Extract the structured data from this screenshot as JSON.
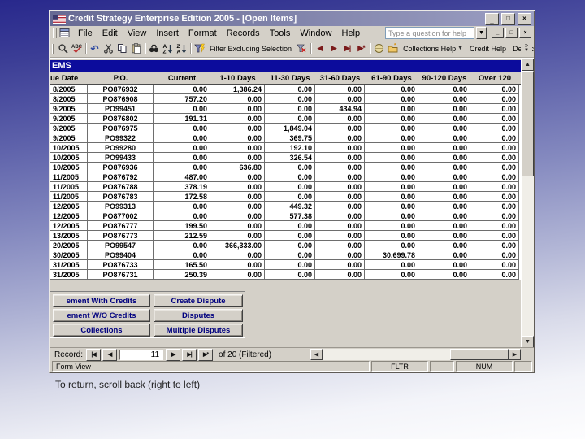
{
  "window": {
    "title": "Credit Strategy Enterprise Edition 2005 - [Open Items]"
  },
  "menu": {
    "items": [
      "File",
      "Edit",
      "View",
      "Insert",
      "Format",
      "Records",
      "Tools",
      "Window",
      "Help"
    ],
    "question_box": "Type a question for help"
  },
  "toolbar": {
    "filter_excluding_label": "Filter Excluding Selection",
    "collections_help_label": "Collections Help",
    "credit_help_label": "Credit Help",
    "deductions_help_label": "Deductions Help"
  },
  "form": {
    "header_label": "EMS"
  },
  "table": {
    "columns": [
      "ue Date",
      "P.O.",
      "Current",
      "1-10 Days",
      "11-30 Days",
      "31-60 Days",
      "61-90 Days",
      "90-120 Days",
      "Over 120"
    ],
    "rows": [
      [
        "8/2005",
        "PO876932",
        "0.00",
        "1,386.24",
        "0.00",
        "0.00",
        "0.00",
        "0.00",
        "0.00"
      ],
      [
        "8/2005",
        "PO876908",
        "757.20",
        "0.00",
        "0.00",
        "0.00",
        "0.00",
        "0.00",
        "0.00"
      ],
      [
        "9/2005",
        "PO99451",
        "0.00",
        "0.00",
        "0.00",
        "434.94",
        "0.00",
        "0.00",
        "0.00"
      ],
      [
        "9/2005",
        "PO876802",
        "191.31",
        "0.00",
        "0.00",
        "0.00",
        "0.00",
        "0.00",
        "0.00"
      ],
      [
        "9/2005",
        "PO876975",
        "0.00",
        "0.00",
        "1,849.04",
        "0.00",
        "0.00",
        "0.00",
        "0.00"
      ],
      [
        "9/2005",
        "PO99322",
        "0.00",
        "0.00",
        "369.75",
        "0.00",
        "0.00",
        "0.00",
        "0.00"
      ],
      [
        "10/2005",
        "PO99280",
        "0.00",
        "0.00",
        "192.10",
        "0.00",
        "0.00",
        "0.00",
        "0.00"
      ],
      [
        "10/2005",
        "PO99433",
        "0.00",
        "0.00",
        "326.54",
        "0.00",
        "0.00",
        "0.00",
        "0.00"
      ],
      [
        "10/2005",
        "PO876936",
        "0.00",
        "636.80",
        "0.00",
        "0.00",
        "0.00",
        "0.00",
        "0.00"
      ],
      [
        "11/2005",
        "PO876792",
        "487.00",
        "0.00",
        "0.00",
        "0.00",
        "0.00",
        "0.00",
        "0.00"
      ],
      [
        "11/2005",
        "PO876788",
        "378.19",
        "0.00",
        "0.00",
        "0.00",
        "0.00",
        "0.00",
        "0.00"
      ],
      [
        "11/2005",
        "PO876783",
        "172.58",
        "0.00",
        "0.00",
        "0.00",
        "0.00",
        "0.00",
        "0.00"
      ],
      [
        "12/2005",
        "PO99313",
        "0.00",
        "0.00",
        "449.32",
        "0.00",
        "0.00",
        "0.00",
        "0.00"
      ],
      [
        "12/2005",
        "PO877002",
        "0.00",
        "0.00",
        "577.38",
        "0.00",
        "0.00",
        "0.00",
        "0.00"
      ],
      [
        "12/2005",
        "PO876777",
        "199.50",
        "0.00",
        "0.00",
        "0.00",
        "0.00",
        "0.00",
        "0.00"
      ],
      [
        "13/2005",
        "PO876773",
        "212.59",
        "0.00",
        "0.00",
        "0.00",
        "0.00",
        "0.00",
        "0.00"
      ],
      [
        "20/2005",
        "PO99547",
        "0.00",
        "366,333.00",
        "0.00",
        "0.00",
        "0.00",
        "0.00",
        "0.00"
      ],
      [
        "30/2005",
        "PO99404",
        "0.00",
        "0.00",
        "0.00",
        "0.00",
        "30,699.78",
        "0.00",
        "0.00"
      ],
      [
        "31/2005",
        "PO876733",
        "165.50",
        "0.00",
        "0.00",
        "0.00",
        "0.00",
        "0.00",
        "0.00"
      ],
      [
        "31/2005",
        "PO876731",
        "250.39",
        "0.00",
        "0.00",
        "0.00",
        "0.00",
        "0.00",
        "0.00"
      ]
    ]
  },
  "action_buttons": {
    "rows": [
      [
        "ement With Credits",
        "Create Dispute"
      ],
      [
        "ement W/O Credits",
        "Disputes"
      ],
      [
        "Collections",
        "Multiple Disputes"
      ]
    ]
  },
  "record_nav": {
    "label": "Record:",
    "current": "11",
    "of_text": "of 20 (Filtered)"
  },
  "status_bar": {
    "mode": "Form View",
    "fltr": "FLTR",
    "num": "NUM"
  },
  "caption": "To return, scroll back (right to left)",
  "colors": {
    "ems_bar": "#0c0c9c",
    "button_text": "#00007f",
    "nav_arrow": "#7b1b1b",
    "title_bar_left": "#676a94",
    "title_bar_right": "#9b9ec2"
  }
}
